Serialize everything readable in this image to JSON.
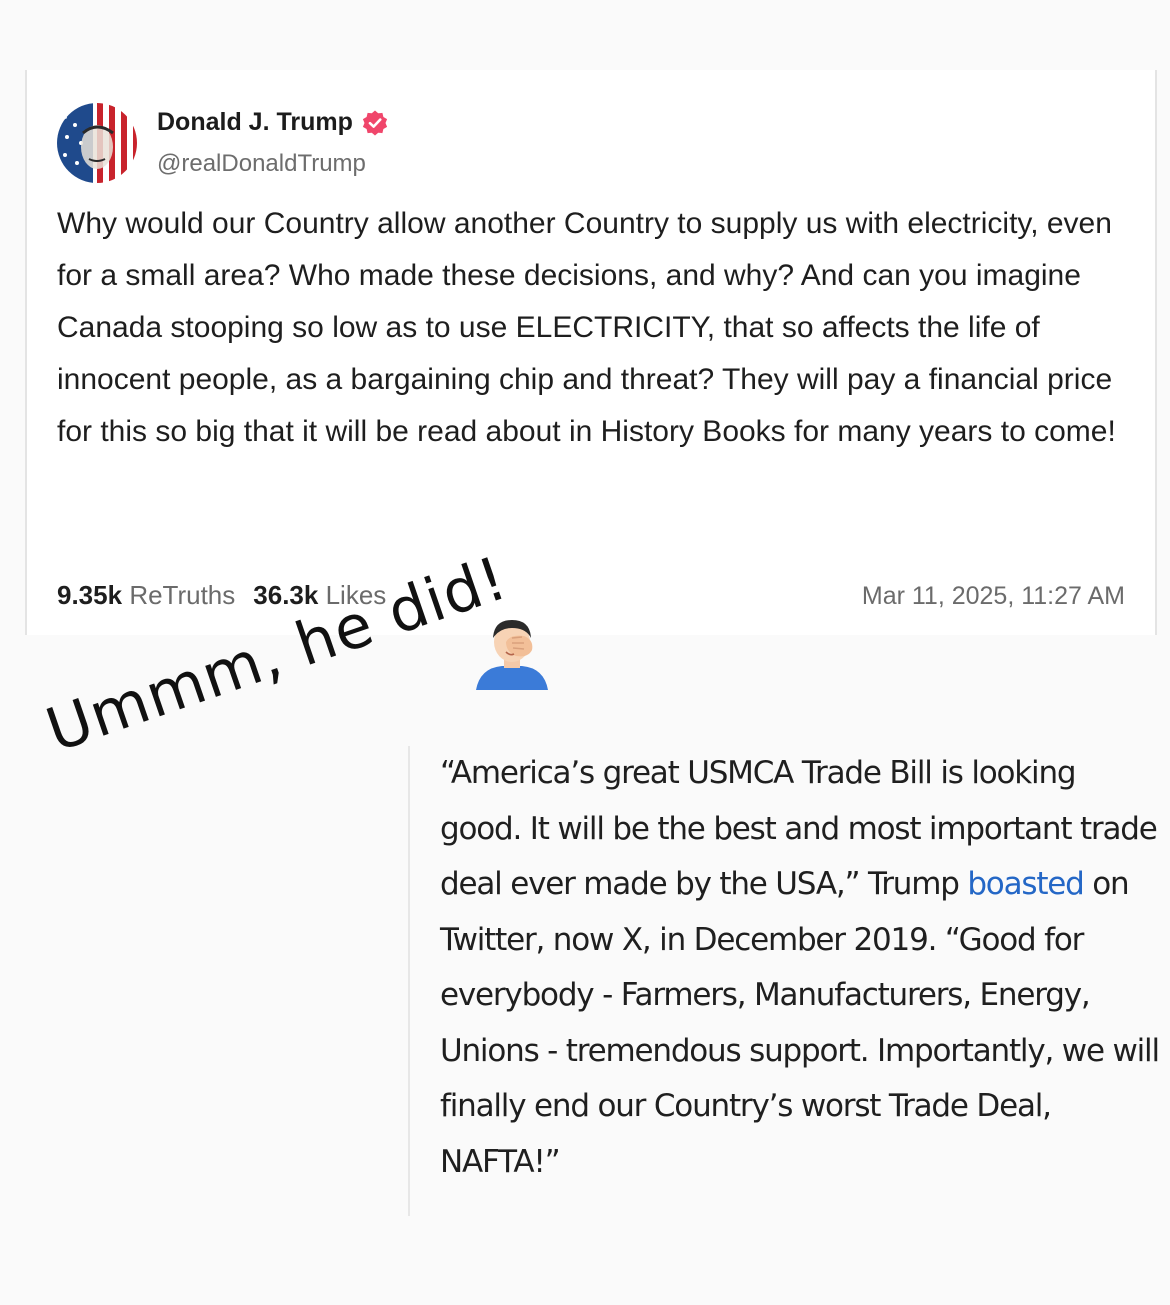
{
  "post": {
    "author_name": "Donald J. Trump",
    "handle": "@realDonaldTrump",
    "body": "Why would our Country allow another Country to supply us with electricity, even for a small area? Who made these decisions, and why? And can you imagine Canada stooping so low as to use ELECTRICITY, that so affects the life of innocent people, as a bargaining chip and threat? They will pay a financial price for this so big that it will be read about in History Books for many years to come!",
    "retruths_count": "9.35k",
    "retruths_label": "ReTruths",
    "likes_count": "36.3k",
    "likes_label": "Likes",
    "timestamp": "Mar 11, 2025, 11:27 AM",
    "verified_icon": "verified-badge-icon",
    "verified_color": "#f0466b"
  },
  "annotation": {
    "text": "Ummm, he did!",
    "emoji": "🤦‍♂️",
    "emoji_icon": "facepalm-icon"
  },
  "quote": {
    "part1": "“America’s great USMCA Trade Bill is looking good. It will be the best and most important trade deal ever made by the USA,” Trump ",
    "link_text": "boasted",
    "part2": " on Twitter, now X, in December 2019. “Good for everybody - Farmers, Manufacturers, Energy, Unions - tremendous support. Importantly, we will finally end our Country’s worst Trade Deal, NAFTA!”",
    "link_color": "#2467c6"
  }
}
